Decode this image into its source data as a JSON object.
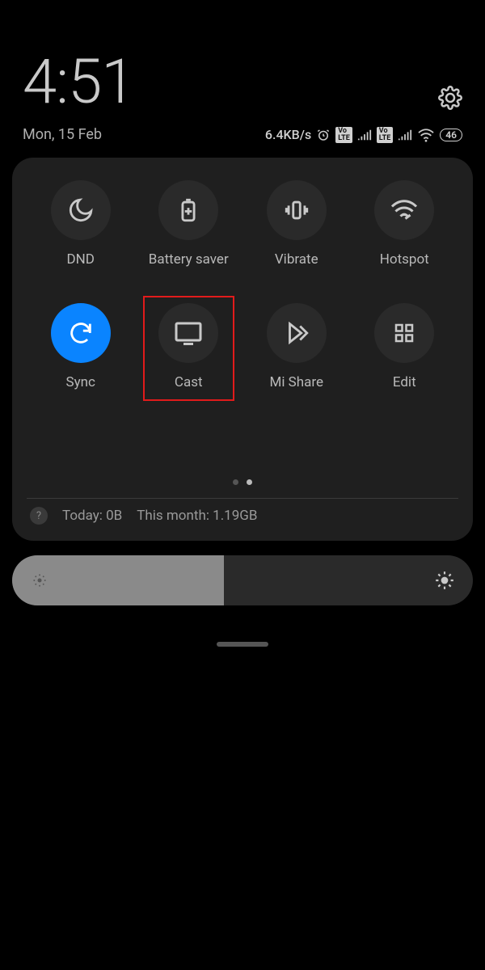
{
  "status": {
    "time": "4:51",
    "date": "Mon, 15 Feb",
    "net_speed": "6.4KB/s",
    "battery": "46"
  },
  "tiles": {
    "dnd": "DND",
    "battery_saver": "Battery saver",
    "vibrate": "Vibrate",
    "hotspot": "Hotspot",
    "sync": "Sync",
    "cast": "Cast",
    "mishare": "Mi Share",
    "edit": "Edit"
  },
  "usage": {
    "today": "Today: 0B",
    "month": "This month: 1.19GB"
  },
  "brightness_percent": 46,
  "highlighted_tile": "cast"
}
